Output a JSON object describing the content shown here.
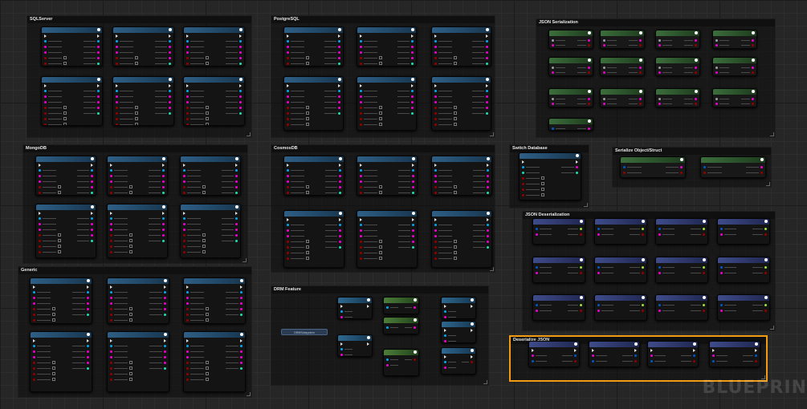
{
  "comments": {
    "sqlserver": "SQLServer",
    "postgresql": "PostgreSQL",
    "json_serialization": "JSON Serialization",
    "mongodb": "MongoDB",
    "cosmosdb": "CosmosDB",
    "switch_database": "Switch Database",
    "serialize_object": "Serialize Object/Struct",
    "json_deserialization": "JSON Deserialization",
    "generic": "Generic",
    "drm_feature": "DRM Feature",
    "deserialize_json": "Deserialize JSON"
  },
  "drm": {
    "subsystem_label": "DRMSubsystem"
  },
  "watermark": "BLUEPRIN",
  "colors": {
    "selection": "#f39c12",
    "exec_pin": "#dcdcdc",
    "object_pin": "#00a8f0",
    "string_pin": "#f000d0",
    "bool_pin": "#950000",
    "struct_pin": "#0058c8",
    "int_pin": "#1fe0b0",
    "wildcard_pin": "#9aa0a8",
    "float_pin": "#9ce43a"
  }
}
